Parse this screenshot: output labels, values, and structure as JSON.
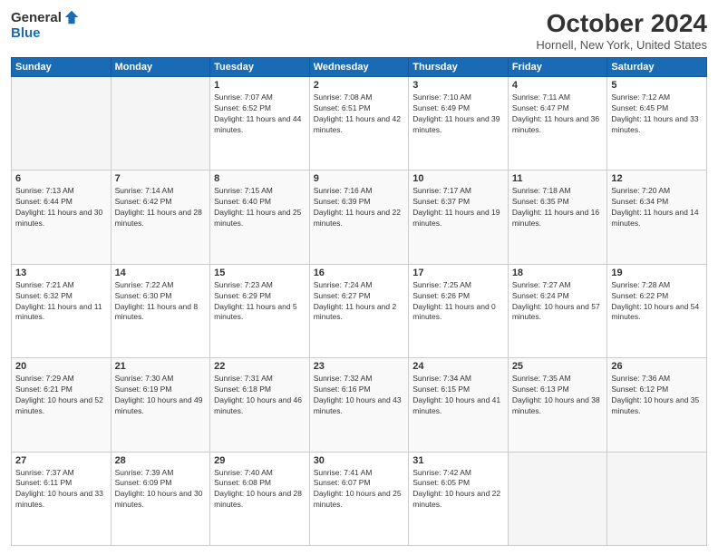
{
  "logo": {
    "general": "General",
    "blue": "Blue"
  },
  "header": {
    "title": "October 2024",
    "subtitle": "Hornell, New York, United States"
  },
  "weekdays": [
    "Sunday",
    "Monday",
    "Tuesday",
    "Wednesday",
    "Thursday",
    "Friday",
    "Saturday"
  ],
  "weeks": [
    [
      {
        "day": "",
        "empty": true
      },
      {
        "day": "",
        "empty": true
      },
      {
        "day": "1",
        "sunrise": "7:07 AM",
        "sunset": "6:52 PM",
        "daylight": "11 hours and 44 minutes."
      },
      {
        "day": "2",
        "sunrise": "7:08 AM",
        "sunset": "6:51 PM",
        "daylight": "11 hours and 42 minutes."
      },
      {
        "day": "3",
        "sunrise": "7:10 AM",
        "sunset": "6:49 PM",
        "daylight": "11 hours and 39 minutes."
      },
      {
        "day": "4",
        "sunrise": "7:11 AM",
        "sunset": "6:47 PM",
        "daylight": "11 hours and 36 minutes."
      },
      {
        "day": "5",
        "sunrise": "7:12 AM",
        "sunset": "6:45 PM",
        "daylight": "11 hours and 33 minutes."
      }
    ],
    [
      {
        "day": "6",
        "sunrise": "7:13 AM",
        "sunset": "6:44 PM",
        "daylight": "11 hours and 30 minutes."
      },
      {
        "day": "7",
        "sunrise": "7:14 AM",
        "sunset": "6:42 PM",
        "daylight": "11 hours and 28 minutes."
      },
      {
        "day": "8",
        "sunrise": "7:15 AM",
        "sunset": "6:40 PM",
        "daylight": "11 hours and 25 minutes."
      },
      {
        "day": "9",
        "sunrise": "7:16 AM",
        "sunset": "6:39 PM",
        "daylight": "11 hours and 22 minutes."
      },
      {
        "day": "10",
        "sunrise": "7:17 AM",
        "sunset": "6:37 PM",
        "daylight": "11 hours and 19 minutes."
      },
      {
        "day": "11",
        "sunrise": "7:18 AM",
        "sunset": "6:35 PM",
        "daylight": "11 hours and 16 minutes."
      },
      {
        "day": "12",
        "sunrise": "7:20 AM",
        "sunset": "6:34 PM",
        "daylight": "11 hours and 14 minutes."
      }
    ],
    [
      {
        "day": "13",
        "sunrise": "7:21 AM",
        "sunset": "6:32 PM",
        "daylight": "11 hours and 11 minutes."
      },
      {
        "day": "14",
        "sunrise": "7:22 AM",
        "sunset": "6:30 PM",
        "daylight": "11 hours and 8 minutes."
      },
      {
        "day": "15",
        "sunrise": "7:23 AM",
        "sunset": "6:29 PM",
        "daylight": "11 hours and 5 minutes."
      },
      {
        "day": "16",
        "sunrise": "7:24 AM",
        "sunset": "6:27 PM",
        "daylight": "11 hours and 2 minutes."
      },
      {
        "day": "17",
        "sunrise": "7:25 AM",
        "sunset": "6:26 PM",
        "daylight": "11 hours and 0 minutes."
      },
      {
        "day": "18",
        "sunrise": "7:27 AM",
        "sunset": "6:24 PM",
        "daylight": "10 hours and 57 minutes."
      },
      {
        "day": "19",
        "sunrise": "7:28 AM",
        "sunset": "6:22 PM",
        "daylight": "10 hours and 54 minutes."
      }
    ],
    [
      {
        "day": "20",
        "sunrise": "7:29 AM",
        "sunset": "6:21 PM",
        "daylight": "10 hours and 52 minutes."
      },
      {
        "day": "21",
        "sunrise": "7:30 AM",
        "sunset": "6:19 PM",
        "daylight": "10 hours and 49 minutes."
      },
      {
        "day": "22",
        "sunrise": "7:31 AM",
        "sunset": "6:18 PM",
        "daylight": "10 hours and 46 minutes."
      },
      {
        "day": "23",
        "sunrise": "7:32 AM",
        "sunset": "6:16 PM",
        "daylight": "10 hours and 43 minutes."
      },
      {
        "day": "24",
        "sunrise": "7:34 AM",
        "sunset": "6:15 PM",
        "daylight": "10 hours and 41 minutes."
      },
      {
        "day": "25",
        "sunrise": "7:35 AM",
        "sunset": "6:13 PM",
        "daylight": "10 hours and 38 minutes."
      },
      {
        "day": "26",
        "sunrise": "7:36 AM",
        "sunset": "6:12 PM",
        "daylight": "10 hours and 35 minutes."
      }
    ],
    [
      {
        "day": "27",
        "sunrise": "7:37 AM",
        "sunset": "6:11 PM",
        "daylight": "10 hours and 33 minutes."
      },
      {
        "day": "28",
        "sunrise": "7:39 AM",
        "sunset": "6:09 PM",
        "daylight": "10 hours and 30 minutes."
      },
      {
        "day": "29",
        "sunrise": "7:40 AM",
        "sunset": "6:08 PM",
        "daylight": "10 hours and 28 minutes."
      },
      {
        "day": "30",
        "sunrise": "7:41 AM",
        "sunset": "6:07 PM",
        "daylight": "10 hours and 25 minutes."
      },
      {
        "day": "31",
        "sunrise": "7:42 AM",
        "sunset": "6:05 PM",
        "daylight": "10 hours and 22 minutes."
      },
      {
        "day": "",
        "empty": true
      },
      {
        "day": "",
        "empty": true
      }
    ]
  ]
}
